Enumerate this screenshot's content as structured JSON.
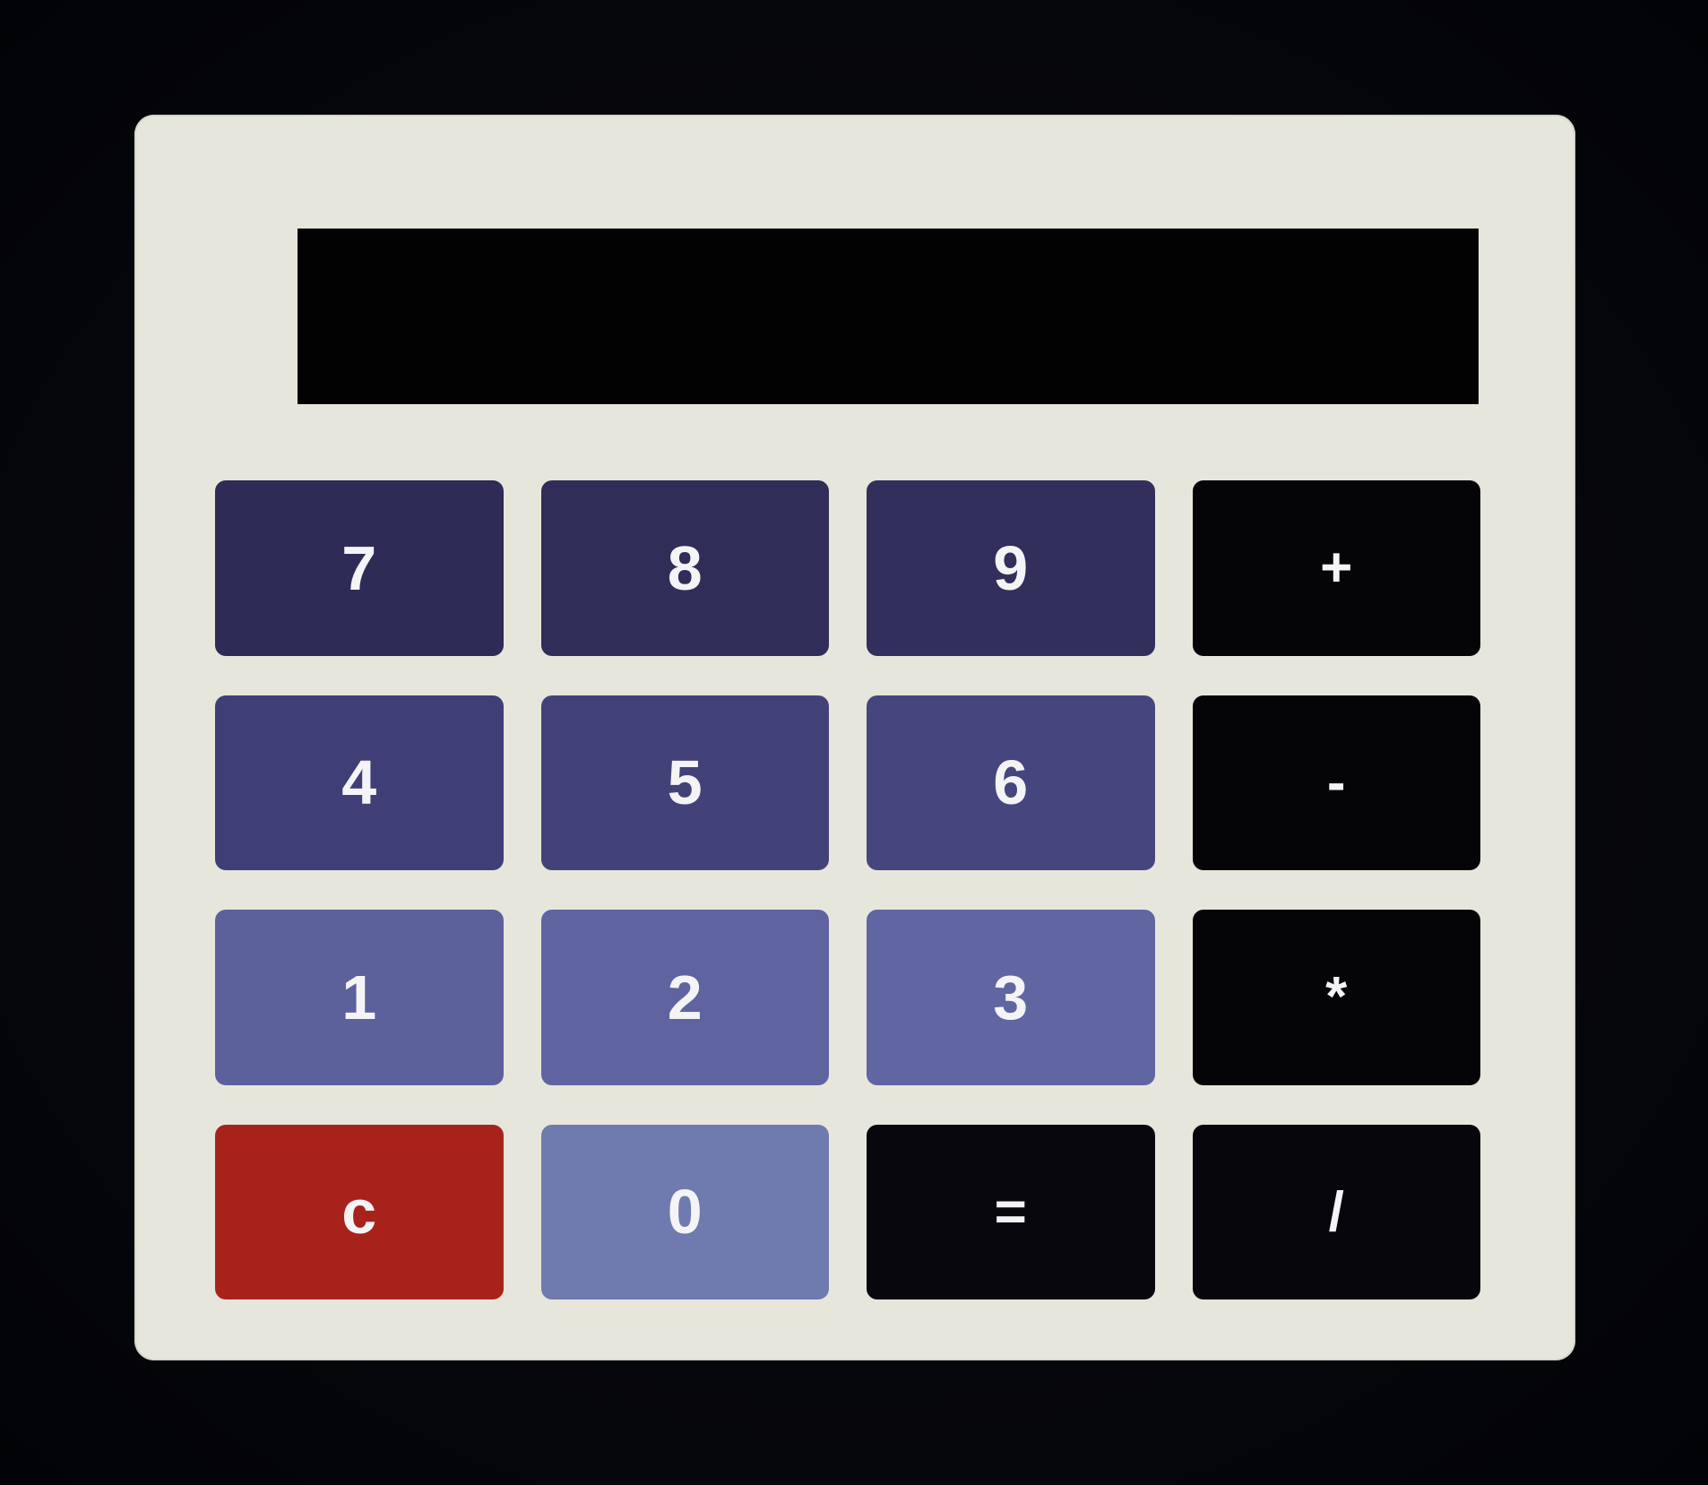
{
  "calculator": {
    "display": {
      "value": ""
    },
    "keys": [
      {
        "label": "7",
        "kind": "digit",
        "color": "#2e2b56",
        "name": "key-7-button"
      },
      {
        "label": "8",
        "kind": "digit",
        "color": "#302d58",
        "name": "key-8-button"
      },
      {
        "label": "9",
        "kind": "digit",
        "color": "#322f5c",
        "name": "key-9-button"
      },
      {
        "label": "+",
        "kind": "operator",
        "color": "#050407",
        "name": "plus-button"
      },
      {
        "label": "4",
        "kind": "digit",
        "color": "#3f3e76",
        "name": "key-4-button"
      },
      {
        "label": "5",
        "kind": "digit",
        "color": "#434278",
        "name": "key-5-button"
      },
      {
        "label": "6",
        "kind": "digit",
        "color": "#46467e",
        "name": "key-6-button"
      },
      {
        "label": "-",
        "kind": "operator",
        "color": "#050407",
        "name": "minus-button"
      },
      {
        "label": "1",
        "kind": "digit",
        "color": "#5c619c",
        "name": "key-1-button"
      },
      {
        "label": "2",
        "kind": "digit",
        "color": "#5f64a0",
        "name": "key-2-button"
      },
      {
        "label": "3",
        "kind": "digit",
        "color": "#6066a2",
        "name": "key-3-button"
      },
      {
        "label": "*",
        "kind": "operator",
        "color": "#050407",
        "name": "multiply-button"
      },
      {
        "label": "c",
        "kind": "clear",
        "color": "#a8221c",
        "name": "clear-button"
      },
      {
        "label": "0",
        "kind": "digit",
        "color": "#6f7aae",
        "name": "key-0-button"
      },
      {
        "label": "=",
        "kind": "equals",
        "color": "#08070d",
        "name": "equals-button"
      },
      {
        "label": "/",
        "kind": "operator",
        "color": "#07060c",
        "name": "divide-button"
      }
    ]
  }
}
